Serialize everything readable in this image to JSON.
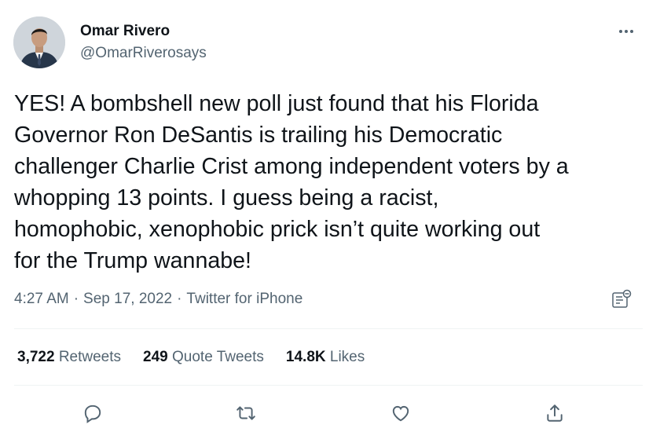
{
  "user": {
    "display_name": "Omar Rivero",
    "handle": "@OmarRiverosays",
    "avatar_icon": "profile-photo"
  },
  "tweet": {
    "text": "YES! A bombshell new poll just found that his Florida\nGovernor Ron DeSantis is trailing his Democratic\nchallenger Charlie Crist among independent voters by a\nwhopping 13 points. I guess being a racist,\nhomophobic, xenophobic prick isn’t quite working out\nfor the Trump wannabe!",
    "time": "4:27 AM",
    "date": "Sep 17, 2022",
    "source": "Twitter for iPhone",
    "separator": "·"
  },
  "stats": {
    "retweets_count": "3,722",
    "retweets_label": "Retweets",
    "quotes_count": "249",
    "quotes_label": "Quote Tweets",
    "likes_count": "14.8K",
    "likes_label": "Likes"
  },
  "icons": {
    "more": "more-icon",
    "analytics": "analytics-icon",
    "reply": "reply-icon",
    "retweet": "retweet-icon",
    "like": "like-icon",
    "share": "share-icon"
  },
  "colors": {
    "text_primary": "#0f1419",
    "text_secondary": "#536471",
    "divider": "#eff3f4"
  }
}
